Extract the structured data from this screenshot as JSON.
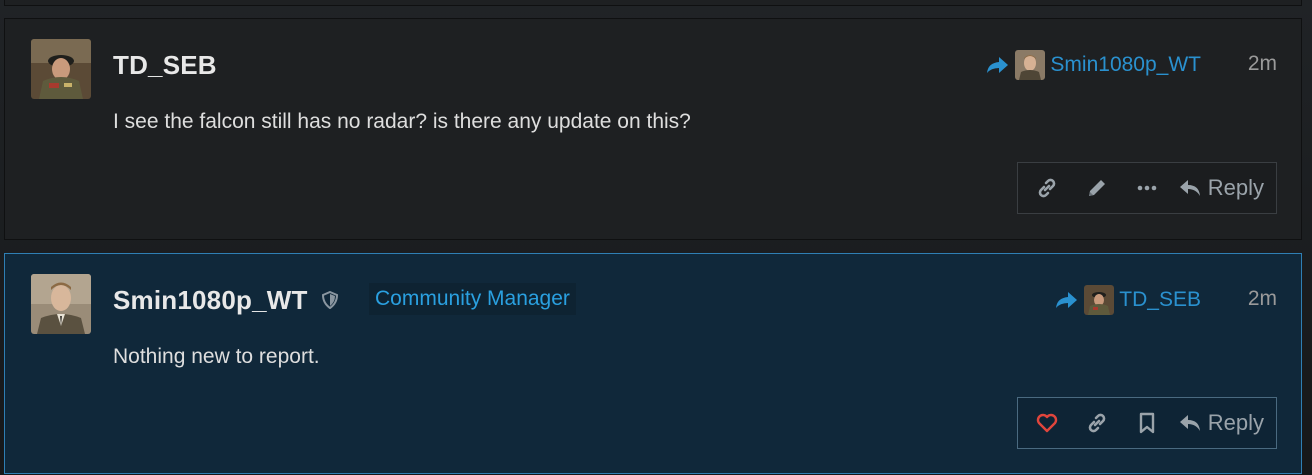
{
  "posts": [
    {
      "username": "TD_SEB",
      "reply_to": "Smin1080p_WT",
      "time": "2m",
      "body": "I see the falcon still has no radar? is there any update on this?",
      "actions": [
        "link-icon",
        "pencil-icon",
        "ellipsis-icon"
      ],
      "reply_label": "Reply"
    },
    {
      "username": "Smin1080p_WT",
      "flair": "Community Manager",
      "reply_to": "TD_SEB",
      "time": "2m",
      "body": "Nothing new to report.",
      "actions": [
        "heart-icon",
        "link-icon",
        "bookmark-icon"
      ],
      "reply_label": "Reply"
    }
  ],
  "colors": {
    "accent": "#2a91cf",
    "highlight_border": "#2f7fb4",
    "heart": "#e0453c"
  }
}
